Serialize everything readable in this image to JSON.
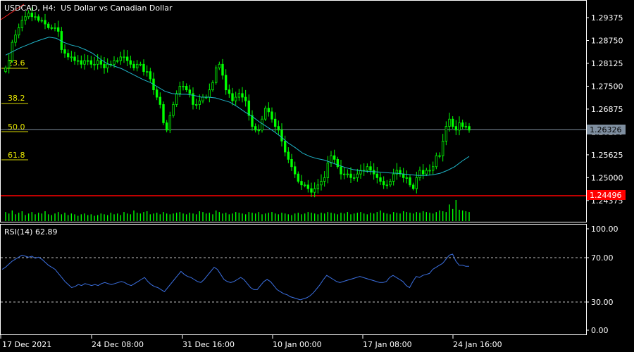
{
  "header": {
    "symbol": "USDCAD",
    "timeframe": "H4",
    "description": "US Dollar vs Canadian Dollar"
  },
  "colors": {
    "background": "#000000",
    "candle": "#00ff00",
    "grid": "#ffffff",
    "ma": "#1fb5c8",
    "rsi": "#3b6fe0",
    "fib": "#d8d800",
    "bid_line": "#7f8fa0",
    "support_line": "#ff0000"
  },
  "price_axis": {
    "ticks": [
      "1.29375",
      "1.28750",
      "1.28125",
      "1.27500",
      "1.26875",
      "1.26250",
      "1.25625",
      "1.25000",
      "1.24375"
    ],
    "current_price": "1.26326",
    "support_price": "1.24496"
  },
  "fibonacci": {
    "levels": [
      "23.6",
      "38.2",
      "50.0",
      "61.8"
    ]
  },
  "rsi": {
    "label": "RSI(14) 62.89",
    "ticks": [
      "100.00",
      "70.00",
      "30.00",
      "0.00"
    ],
    "levels": [
      70,
      30
    ]
  },
  "time_axis": {
    "labels": [
      "17 Dec 2021",
      "24 Dec 08:00",
      "31 Dec 16:00",
      "10 Jan 00:00",
      "17 Jan 08:00",
      "24 Jan 16:00"
    ]
  },
  "chart_data": {
    "type": "candlestick",
    "price_range": [
      1.2416,
      1.2978
    ],
    "rsi_range": [
      0,
      100
    ],
    "closes": [
      1.28,
      1.282,
      1.287,
      1.289,
      1.291,
      1.293,
      1.294,
      1.295,
      1.294,
      1.294,
      1.293,
      1.293,
      1.292,
      1.291,
      1.291,
      1.291,
      1.29,
      1.285,
      1.284,
      1.283,
      1.283,
      1.282,
      1.282,
      1.281,
      1.282,
      1.282,
      1.281,
      1.281,
      1.282,
      1.281,
      1.28,
      1.281,
      1.281,
      1.282,
      1.282,
      1.283,
      1.283,
      1.282,
      1.281,
      1.28,
      1.281,
      1.281,
      1.279,
      1.279,
      1.277,
      1.274,
      1.272,
      1.27,
      1.265,
      1.263,
      1.267,
      1.27,
      1.273,
      1.275,
      1.275,
      1.274,
      1.273,
      1.27,
      1.27,
      1.271,
      1.272,
      1.272,
      1.274,
      1.276,
      1.28,
      1.281,
      1.278,
      1.274,
      1.273,
      1.271,
      1.272,
      1.273,
      1.272,
      1.271,
      1.267,
      1.264,
      1.263,
      1.263,
      1.266,
      1.269,
      1.268,
      1.266,
      1.264,
      1.263,
      1.26,
      1.257,
      1.255,
      1.253,
      1.251,
      1.249,
      1.248,
      1.248,
      1.247,
      1.246,
      1.247,
      1.248,
      1.249,
      1.25,
      1.254,
      1.256,
      1.255,
      1.253,
      1.251,
      1.251,
      1.251,
      1.25,
      1.25,
      1.251,
      1.252,
      1.252,
      1.253,
      1.252,
      1.251,
      1.25,
      1.249,
      1.248,
      1.248,
      1.249,
      1.251,
      1.252,
      1.251,
      1.25,
      1.25,
      1.248,
      1.247,
      1.25,
      1.252,
      1.251,
      1.252,
      1.252,
      1.253,
      1.256,
      1.256,
      1.26,
      1.264,
      1.266,
      1.264,
      1.263,
      1.265,
      1.264,
      1.264,
      1.263
    ],
    "ma": [
      1.2835,
      1.2845,
      1.2855,
      1.2863,
      1.2871,
      1.2878,
      1.2884,
      1.2881,
      1.287,
      1.2863,
      1.2858,
      1.285,
      1.284,
      1.2825,
      1.2812,
      1.2805,
      1.2798,
      1.2788,
      1.2778,
      1.2768,
      1.276,
      1.2748,
      1.2736,
      1.273,
      1.2728,
      1.2728,
      1.2725,
      1.272,
      1.272,
      1.2718,
      1.2712,
      1.2706,
      1.2694,
      1.268,
      1.2668,
      1.2653,
      1.264,
      1.2627,
      1.2612,
      1.2595,
      1.2582,
      1.2567,
      1.2558,
      1.2552,
      1.2548,
      1.2541,
      1.2534,
      1.2527,
      1.2522,
      1.2519,
      1.2517,
      1.2516,
      1.2515,
      1.2513,
      1.2512,
      1.251,
      1.2508,
      1.2506,
      1.2506,
      1.2508,
      1.2512,
      1.252,
      1.253,
      1.2545,
      1.2558
    ],
    "rsi_values": [
      60,
      62,
      65,
      68,
      70,
      72,
      74,
      73,
      72,
      73,
      71,
      72,
      70,
      67,
      64,
      62,
      60,
      56,
      52,
      48,
      45,
      42,
      43,
      45,
      44,
      46,
      45,
      44,
      45,
      44,
      46,
      47,
      46,
      45,
      46,
      47,
      48,
      47,
      45,
      44,
      46,
      48,
      50,
      52,
      48,
      45,
      43,
      42,
      40,
      38,
      42,
      46,
      50,
      54,
      58,
      55,
      53,
      52,
      50,
      48,
      47,
      50,
      54,
      58,
      62,
      60,
      55,
      50,
      48,
      47,
      48,
      50,
      52,
      50,
      46,
      42,
      40,
      40,
      44,
      48,
      50,
      48,
      44,
      40,
      38,
      36,
      35,
      33,
      32,
      31,
      30,
      31,
      32,
      34,
      37,
      41,
      45,
      50,
      54,
      52,
      50,
      48,
      47,
      48,
      49,
      50,
      51,
      52,
      53,
      52,
      51,
      50,
      49,
      48,
      47,
      47,
      48,
      52,
      54,
      52,
      50,
      48,
      44,
      42,
      48,
      53,
      52,
      54,
      55,
      56,
      60,
      62,
      64,
      66,
      70,
      74,
      75,
      68,
      64,
      64,
      63,
      63
    ],
    "volume": [
      12,
      10,
      14,
      9,
      11,
      13,
      8,
      10,
      12,
      9,
      11,
      10,
      13,
      9,
      8,
      10,
      12,
      9,
      11,
      8,
      10,
      9,
      7,
      9,
      10,
      8,
      9,
      7,
      8,
      10,
      9,
      8,
      11,
      9,
      10,
      8,
      12,
      10,
      9,
      14,
      11,
      10,
      12,
      13,
      9,
      10,
      11,
      9,
      12,
      10,
      9,
      10,
      11,
      12,
      10,
      9,
      11,
      10,
      9,
      13,
      12,
      10,
      11,
      9,
      14,
      12,
      10,
      11,
      9,
      10,
      12,
      11,
      10,
      9,
      12,
      11,
      10,
      12,
      9,
      10,
      11,
      12,
      10,
      9,
      11,
      10,
      9,
      8,
      10,
      11,
      9,
      10,
      12,
      11,
      10,
      9,
      11,
      10,
      12,
      11,
      10,
      9,
      11,
      10,
      12,
      9,
      10,
      11,
      12,
      10,
      9,
      11,
      10,
      12,
      14,
      11,
      10,
      9,
      12,
      11,
      10,
      13,
      12,
      11,
      10,
      12,
      11,
      13,
      12,
      11,
      10,
      12,
      14,
      13,
      12,
      22,
      16,
      28,
      15,
      14,
      13,
      12
    ]
  }
}
